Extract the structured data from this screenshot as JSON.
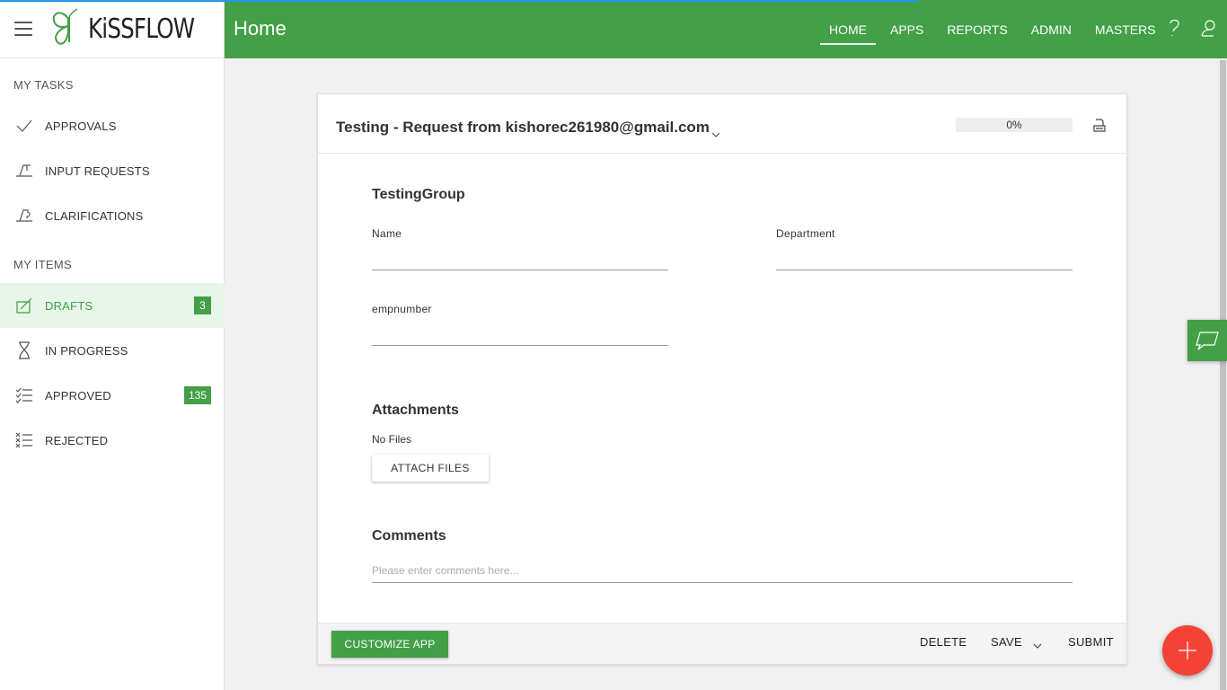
{
  "app": {
    "logo_text": "KiSSFLOW",
    "page_title": "Home"
  },
  "topnav": {
    "items": [
      {
        "label": "HOME",
        "active": true
      },
      {
        "label": "APPS"
      },
      {
        "label": "REPORTS"
      },
      {
        "label": "ADMIN"
      },
      {
        "label": "MASTERS"
      }
    ],
    "icons": [
      "help-icon",
      "user-profile-icon"
    ]
  },
  "sidebar": {
    "my_tasks_title": "MY TASKS",
    "my_tasks": [
      {
        "label": "APPROVALS",
        "icon": "checkmark-icon"
      },
      {
        "label": "INPUT REQUESTS",
        "icon": "input-request-icon"
      },
      {
        "label": "CLARIFICATIONS",
        "icon": "clarification-icon"
      }
    ],
    "my_items_title": "MY ITEMS",
    "my_items": [
      {
        "label": "DRAFTS",
        "icon": "drafts-icon",
        "badge": "3",
        "active": true
      },
      {
        "label": "IN PROGRESS",
        "icon": "hourglass-icon"
      },
      {
        "label": "APPROVED",
        "icon": "approved-list-icon",
        "badge": "135"
      },
      {
        "label": "REJECTED",
        "icon": "rejected-list-icon"
      }
    ]
  },
  "form": {
    "title": "Testing - Request from kishorec261980@gmail.com",
    "progress": "0%",
    "group_title": "TestingGroup",
    "fields": {
      "name_label": "Name",
      "name_value": "",
      "department_label": "Department",
      "department_value": "",
      "empnumber_label": "empnumber",
      "empnumber_value": ""
    },
    "attachments_title": "Attachments",
    "no_files": "No Files",
    "attach_button": "ATTACH FILES",
    "comments_title": "Comments",
    "comments_placeholder": "Please enter comments here..."
  },
  "footer": {
    "customize": "CUSTOMIZE APP",
    "delete": "DELETE",
    "save": "SAVE",
    "submit": "SUBMIT"
  },
  "colors": {
    "brand_green": "#43a047",
    "fab_red": "#f44336",
    "progress_blue": "#2196f3"
  }
}
